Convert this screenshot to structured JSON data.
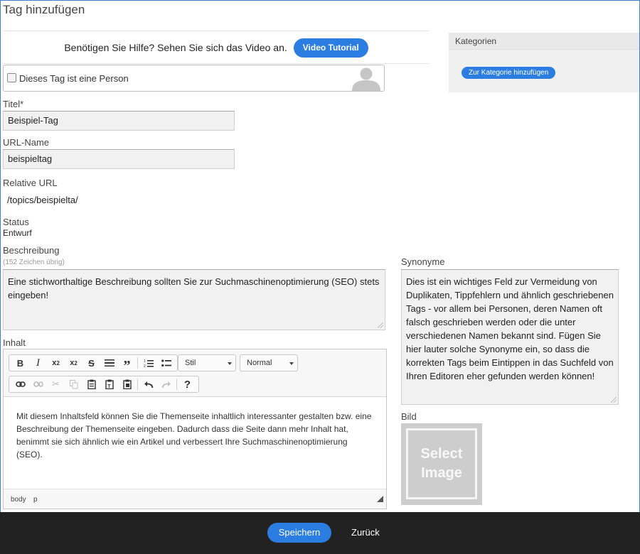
{
  "page": {
    "title": "Tag hinzufügen"
  },
  "help": {
    "text": "Benötigen Sie Hilfe? Sehen Sie sich das Video an.",
    "button": "Video Tutorial"
  },
  "person": {
    "label": "Dieses Tag ist eine Person",
    "checked": false,
    "avatar_icon": "person-silhouette-icon"
  },
  "fields": {
    "title_label": "Titel*",
    "title_value": "Beispiel-Tag",
    "url_name_label": "URL-Name",
    "url_name_value": "beispieltag",
    "relative_url_label": "Relative URL",
    "relative_url_value": "/topics/beispielta/",
    "status_label": "Status",
    "status_value": "Entwurf",
    "description_label": "Beschreibung",
    "description_counter": "(152 Zeichen übrig)",
    "description_value": "Eine stichworthaltige Beschreibung sollten Sie zur Suchmaschinenoptimierung (SEO) stets eingeben!",
    "content_label": "Inhalt"
  },
  "editor": {
    "toolbar_row1": [
      "bold-icon",
      "italic-icon",
      "subscript-icon",
      "superscript-icon",
      "strikethrough-icon",
      "horizontal-rule-icon",
      "blockquote-icon",
      "numbered-list-icon",
      "bulleted-list-icon"
    ],
    "style_combo": "Stil",
    "format_combo": "Normal",
    "toolbar_row2": [
      "link-icon",
      "unlink-icon",
      "cut-icon",
      "copy-icon",
      "paste-icon",
      "paste-text-icon",
      "paste-word-icon",
      "undo-icon",
      "redo-icon",
      "help-icon"
    ],
    "content": "Mit diesem Inhaltsfeld können Sie die Themenseite inhaltlich interessanter gestalten bzw. eine Beschreibung der Themenseite eingeben. Dadurch dass die Seite dann mehr Inhalt hat, benimmt sie sich ähnlich wie ein Artikel und verbessert Ihre Suchmaschinenoptimierung (SEO).",
    "path": [
      "body",
      "p"
    ]
  },
  "categories": {
    "heading": "Kategorien",
    "button": "Zur Kategorie hinzufügen"
  },
  "synonyms": {
    "label": "Synonyme",
    "value": "Dies ist ein wichtiges Feld zur Vermeidung von Duplikaten, Tippfehlern und ähnlich geschriebenen Tags - vor allem bei Personen, deren Namen oft falsch geschrieben werden oder die unter verschiedenen Namen bekannt sind. Fügen Sie hier lauter solche Synonyme ein, so dass die korrekten Tags beim Eintippen in das Suchfeld von Ihren Editoren eher gefunden werden können!"
  },
  "image": {
    "label": "Bild",
    "placeholder_line1": "Select",
    "placeholder_line2": "Image"
  },
  "footer": {
    "save": "Speichern",
    "back": "Zurück"
  },
  "colors": {
    "accent": "#2b7de1",
    "footer_bg": "#222222",
    "frame_border": "#3c7fd4"
  }
}
